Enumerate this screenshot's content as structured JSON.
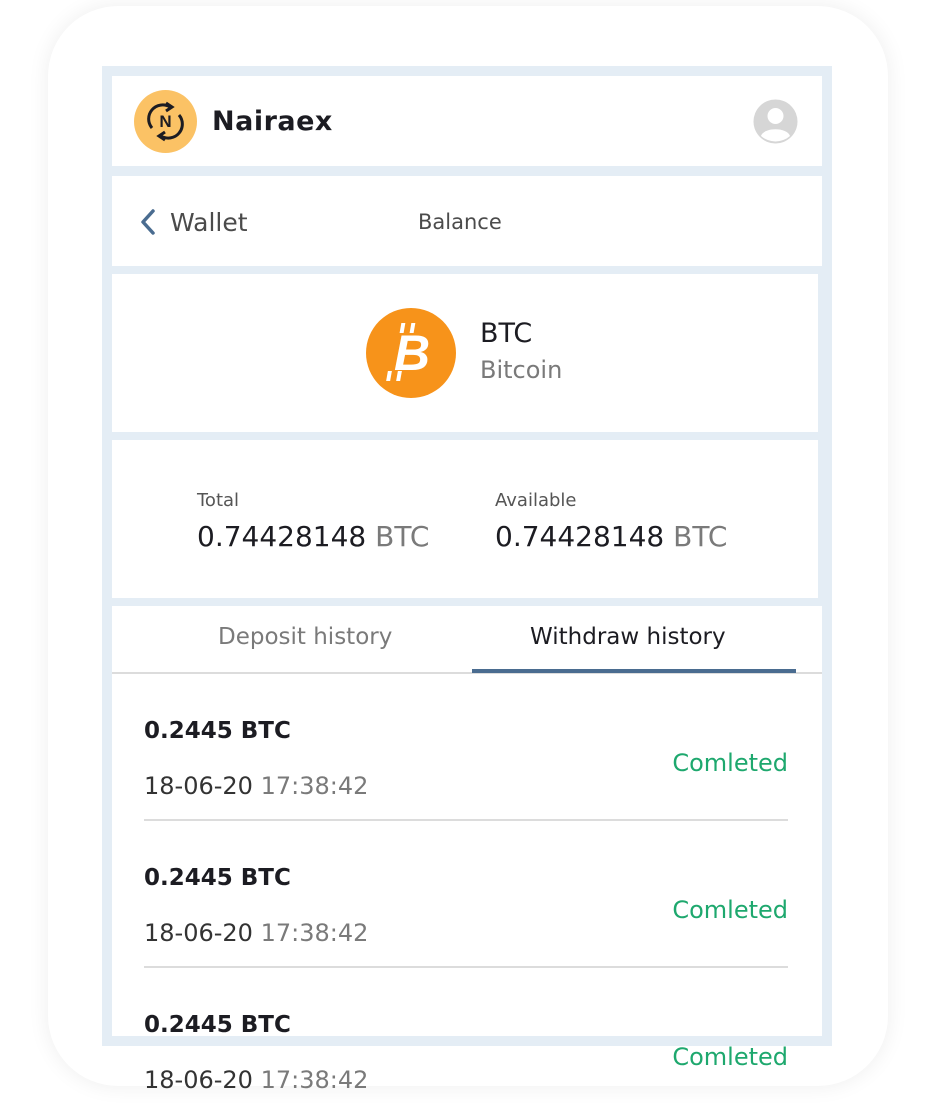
{
  "app": {
    "brand": "Nairaex",
    "logo_icon": "nairaex-logo-icon",
    "avatar_icon": "user-avatar-icon"
  },
  "nav": {
    "back_label": "Wallet",
    "title": "Balance"
  },
  "coin": {
    "symbol": "BTC",
    "name": "Bitcoin",
    "icon": "bitcoin-icon",
    "color": "#f7931a"
  },
  "balances": {
    "total_label": "Total",
    "total_value": "0.74428148",
    "total_unit": "BTC",
    "available_label": "Available",
    "available_value": "0.74428148",
    "available_unit": "BTC"
  },
  "tabs": {
    "deposit": "Deposit history",
    "withdraw": "Withdraw history",
    "active": "withdraw"
  },
  "transactions": [
    {
      "amount": "0.2445 BTC",
      "date": "18-06-20",
      "time": "17:38:42",
      "status": "Comleted"
    },
    {
      "amount": "0.2445 BTC",
      "date": "18-06-20",
      "time": "17:38:42",
      "status": "Comleted"
    },
    {
      "amount": "0.2445 BTC",
      "date": "18-06-20",
      "time": "17:38:42",
      "status": "Comleted"
    }
  ],
  "colors": {
    "accent": "#4a6c90",
    "status_completed": "#1ea86e",
    "logo_bg": "#fbc265"
  }
}
